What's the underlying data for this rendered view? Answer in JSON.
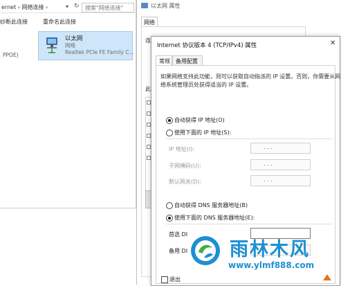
{
  "explorer": {
    "address_path": "ernet  ›  网络连接  ›",
    "search_placeholder": "搜索\"网络连接\"",
    "commands": [
      "纱断此连接",
      "重命名此连接"
    ],
    "adapter": {
      "name": "以太网",
      "status": "网络",
      "device": "Realtek PCIe FE Family C..."
    },
    "left_fragment": "PPOE)"
  },
  "ethernet_properties": {
    "title": "以太网 属性",
    "tab": "网络",
    "fragments": [
      "连",
      "此"
    ]
  },
  "ipv4_dialog": {
    "title": "Internet 协议版本 4 (TCP/IPv4) 属性",
    "tabs": [
      "常规",
      "备用配置"
    ],
    "description_line1": "如果网络支持此功能，则可以获取自动指派的 IP 设置。否则，你需要从网",
    "description_line2": "络系统管理员处获得适当的 IP 设置。",
    "ip_auto_label": "自动获得 IP 地址(O)",
    "ip_manual_label": "使用下面的 IP 地址(S):",
    "ip_fields": [
      {
        "label": "IP 地址(I):",
        "dots": ".     .     ."
      },
      {
        "label": "子网掩码(U):",
        "dots": ".     .     ."
      },
      {
        "label": "默认网关(D):",
        "dots": ".     .     ."
      }
    ],
    "dns_auto_label": "自动获得 DNS 服务器地址(B)",
    "dns_manual_label": "使用下面的 DNS 服务器地址(E):",
    "dns_fields": [
      {
        "label": "首选 DI",
        "dots": ""
      },
      {
        "label": "备用 DI",
        "dots": ""
      }
    ],
    "exit_validate_label": "退出"
  },
  "watermark": {
    "brand": "雨林木风",
    "url": "www.ylmf888.com"
  },
  "colors": {
    "selection": "#cfe5f9",
    "brand_blue": "#1d8fd2",
    "brand_orange": "#e1771f"
  }
}
